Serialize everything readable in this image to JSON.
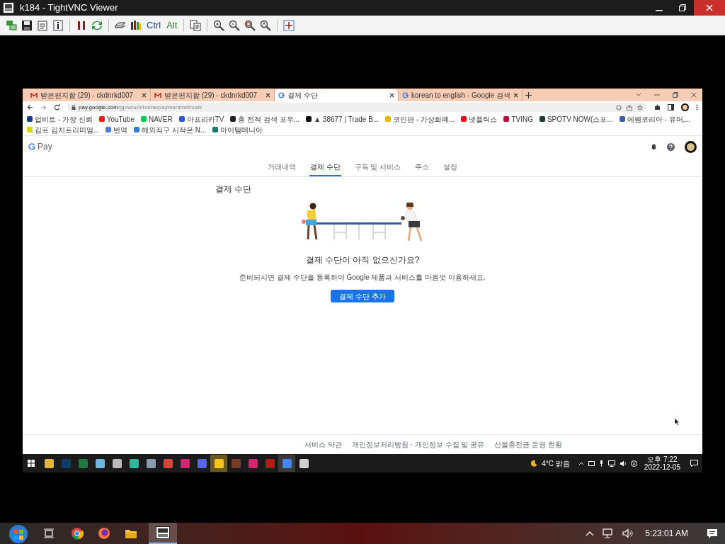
{
  "window": {
    "title": "k184 - TightVNC Viewer"
  },
  "toolbar": {
    "keys": [
      {
        "label": "Ctrl",
        "color": "#1f3f8f"
      },
      {
        "label": "Alt",
        "color": "#2e7d32"
      }
    ]
  },
  "browser": {
    "tabs": [
      {
        "title": "받은편지함 (29) - ckdnrkd007",
        "kind": "mail",
        "selected": false
      },
      {
        "title": "받은편지함 (29) - ckdnrkd007",
        "kind": "mail",
        "selected": false
      },
      {
        "title": "결제 수단",
        "kind": "search",
        "selected": true
      },
      {
        "title": "korean to english - Google 검색",
        "kind": "search",
        "selected": false
      }
    ],
    "url_host": "pay.google.com",
    "url_path": "/gp/w/u/0/home/paymentmethods",
    "bookmarks": [
      {
        "label": "업비트 - 가장 신뢰",
        "color": "#1a3a8a"
      },
      {
        "label": "YouTube",
        "color": "#e62117"
      },
      {
        "label": "NAVER",
        "color": "#03c75a"
      },
      {
        "label": "아프리카TV",
        "color": "#2a5bd7"
      },
      {
        "label": "총 전적 검색 포우...",
        "color": "#222222"
      },
      {
        "label": "▲ 38677 | Trade B...",
        "color": "#111111"
      },
      {
        "label": "코인판 - 가상화폐...",
        "color": "#e8b400"
      },
      {
        "label": "넷플릭스",
        "color": "#e50914"
      },
      {
        "label": "TVING",
        "color": "#b5123a"
      },
      {
        "label": "SPOTV NOW(스포...",
        "color": "#1b3b2e"
      },
      {
        "label": "에펨코리아 - 유머,...",
        "color": "#3b5aa8"
      },
      {
        "label": "김프 김치프리미엄...",
        "color": "#d8d800"
      },
      {
        "label": "번역",
        "color": "#4a7de0"
      },
      {
        "label": "해외직구 시작은 N...",
        "color": "#2f7fd6"
      },
      {
        "label": "아이템매니아",
        "color": "#1a7a6a"
      }
    ]
  },
  "page": {
    "brand": "Pay",
    "nav": [
      {
        "label": "거래내역",
        "selected": false
      },
      {
        "label": "결제 수단",
        "selected": true
      },
      {
        "label": "구독 및 서비스",
        "selected": false
      },
      {
        "label": "주소",
        "selected": false
      },
      {
        "label": "설정",
        "selected": false
      }
    ],
    "heading": "결제 수단",
    "empty_title": "결제 수단이 아직 없으신가요?",
    "empty_text": "준비되시면 결제 수단을 등록하여 Google 제품과 서비스를 마음껏 이용하세요.",
    "button": "결제 수단 추가",
    "footer": [
      "서비스 약관",
      "개인정보처리방침 · 개인정보 수집 및 공유",
      "선불충전금 운영 현황"
    ]
  },
  "remote_taskbar": {
    "weather": "4°C 맑음",
    "time": "오후 7:22",
    "date": "2022-12-05"
  },
  "taskbar": {
    "time": "5:23:01 AM"
  }
}
